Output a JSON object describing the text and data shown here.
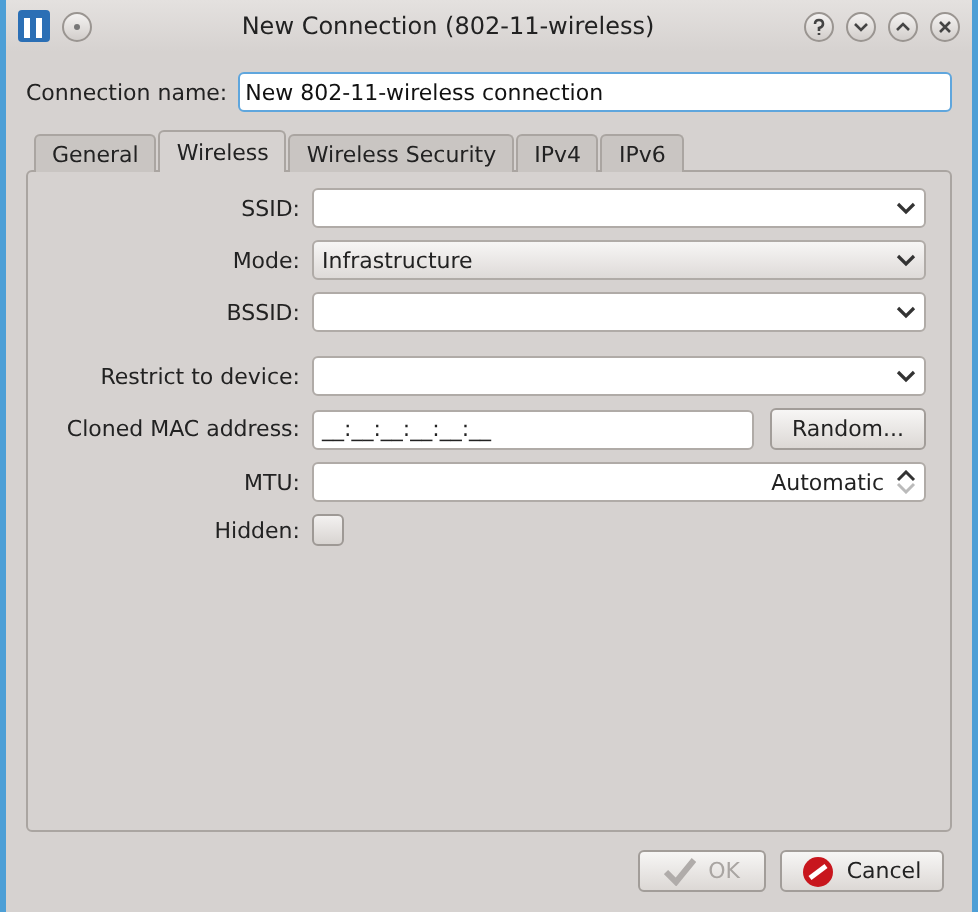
{
  "window": {
    "title": "New Connection (802-11-wireless)"
  },
  "connection_name": {
    "label": "Connection name:",
    "value": "New 802-11-wireless connection"
  },
  "tabs": [
    {
      "label": "General",
      "selected": false
    },
    {
      "label": "Wireless",
      "selected": true
    },
    {
      "label": "Wireless Security",
      "selected": false
    },
    {
      "label": "IPv4",
      "selected": false
    },
    {
      "label": "IPv6",
      "selected": false
    }
  ],
  "groups": [
    [
      {
        "label": "SSID:",
        "kind": "combo-edit"
      },
      {
        "label": "Mode:",
        "kind": "combo",
        "value": "Infrastructure"
      },
      {
        "label": "BSSID:",
        "kind": "combo-edit"
      }
    ],
    [
      {
        "label": "Restrict to device:",
        "kind": "combo-edit"
      },
      {
        "label": "Cloned MAC address:",
        "kind": "text",
        "value": "__:__:__:__:__:__",
        "button": "Random..."
      },
      {
        "label": "MTU:",
        "kind": "spin",
        "value": "Automatic"
      },
      {
        "label": "Hidden:",
        "kind": "checkbox",
        "checked": false
      }
    ]
  ],
  "buttons": [
    {
      "label": "OK",
      "kind": "ok",
      "disabled": true
    },
    {
      "label": "Cancel",
      "kind": "cancel",
      "disabled": false
    }
  ]
}
